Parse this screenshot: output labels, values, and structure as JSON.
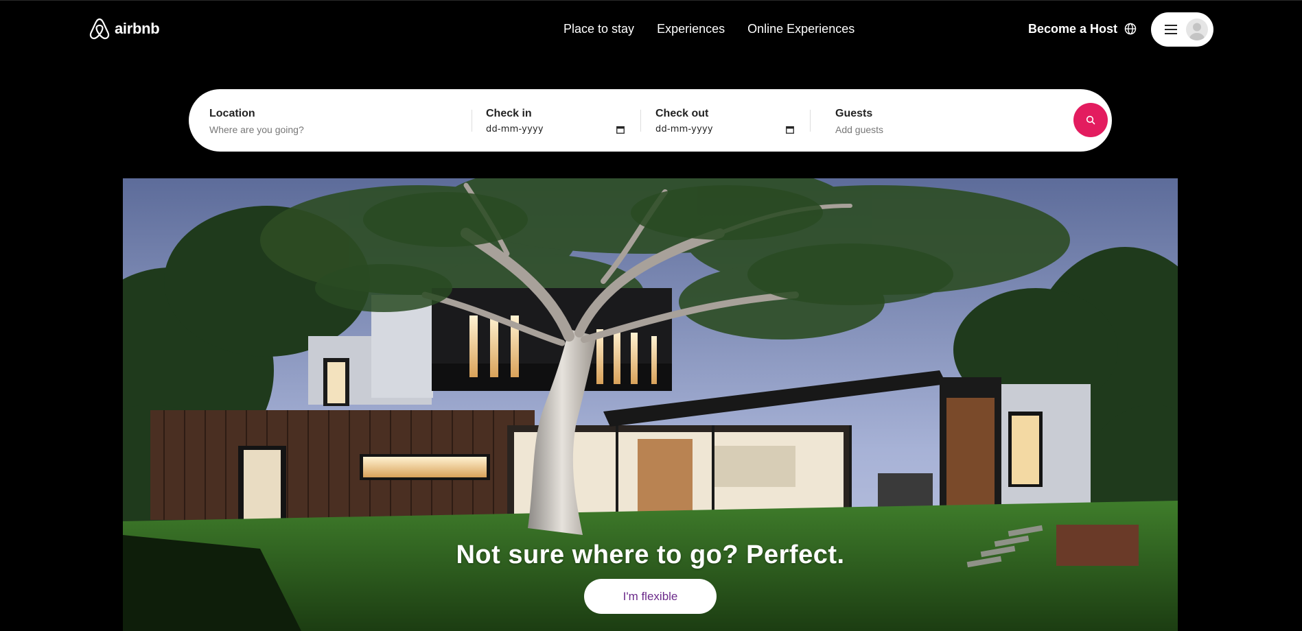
{
  "brand": {
    "name": "airbnb",
    "logo_icon": "airbnb-logo-icon"
  },
  "nav": {
    "items": [
      {
        "label": "Place to stay"
      },
      {
        "label": "Experiences"
      },
      {
        "label": "Online Experiences"
      }
    ]
  },
  "header": {
    "host_label": "Become a Host",
    "language_icon": "globe-icon",
    "menu_icon": "hamburger-icon",
    "avatar_icon": "user-avatar-icon"
  },
  "search": {
    "location": {
      "label": "Location",
      "placeholder": "Where are you going?"
    },
    "check_in": {
      "label": "Check in",
      "value": "dd-mm-yyyy"
    },
    "check_out": {
      "label": "Check out",
      "value": "dd-mm-yyyy"
    },
    "guests": {
      "label": "Guests",
      "placeholder": "Add guests"
    },
    "button_icon": "search-icon",
    "accent_color": "#e31c5f"
  },
  "hero": {
    "title": "Not sure where to go? Perfect.",
    "button_label": "I'm flexible",
    "button_text_color": "#6b2a8a",
    "image": "modern-house-at-dusk-photo"
  }
}
